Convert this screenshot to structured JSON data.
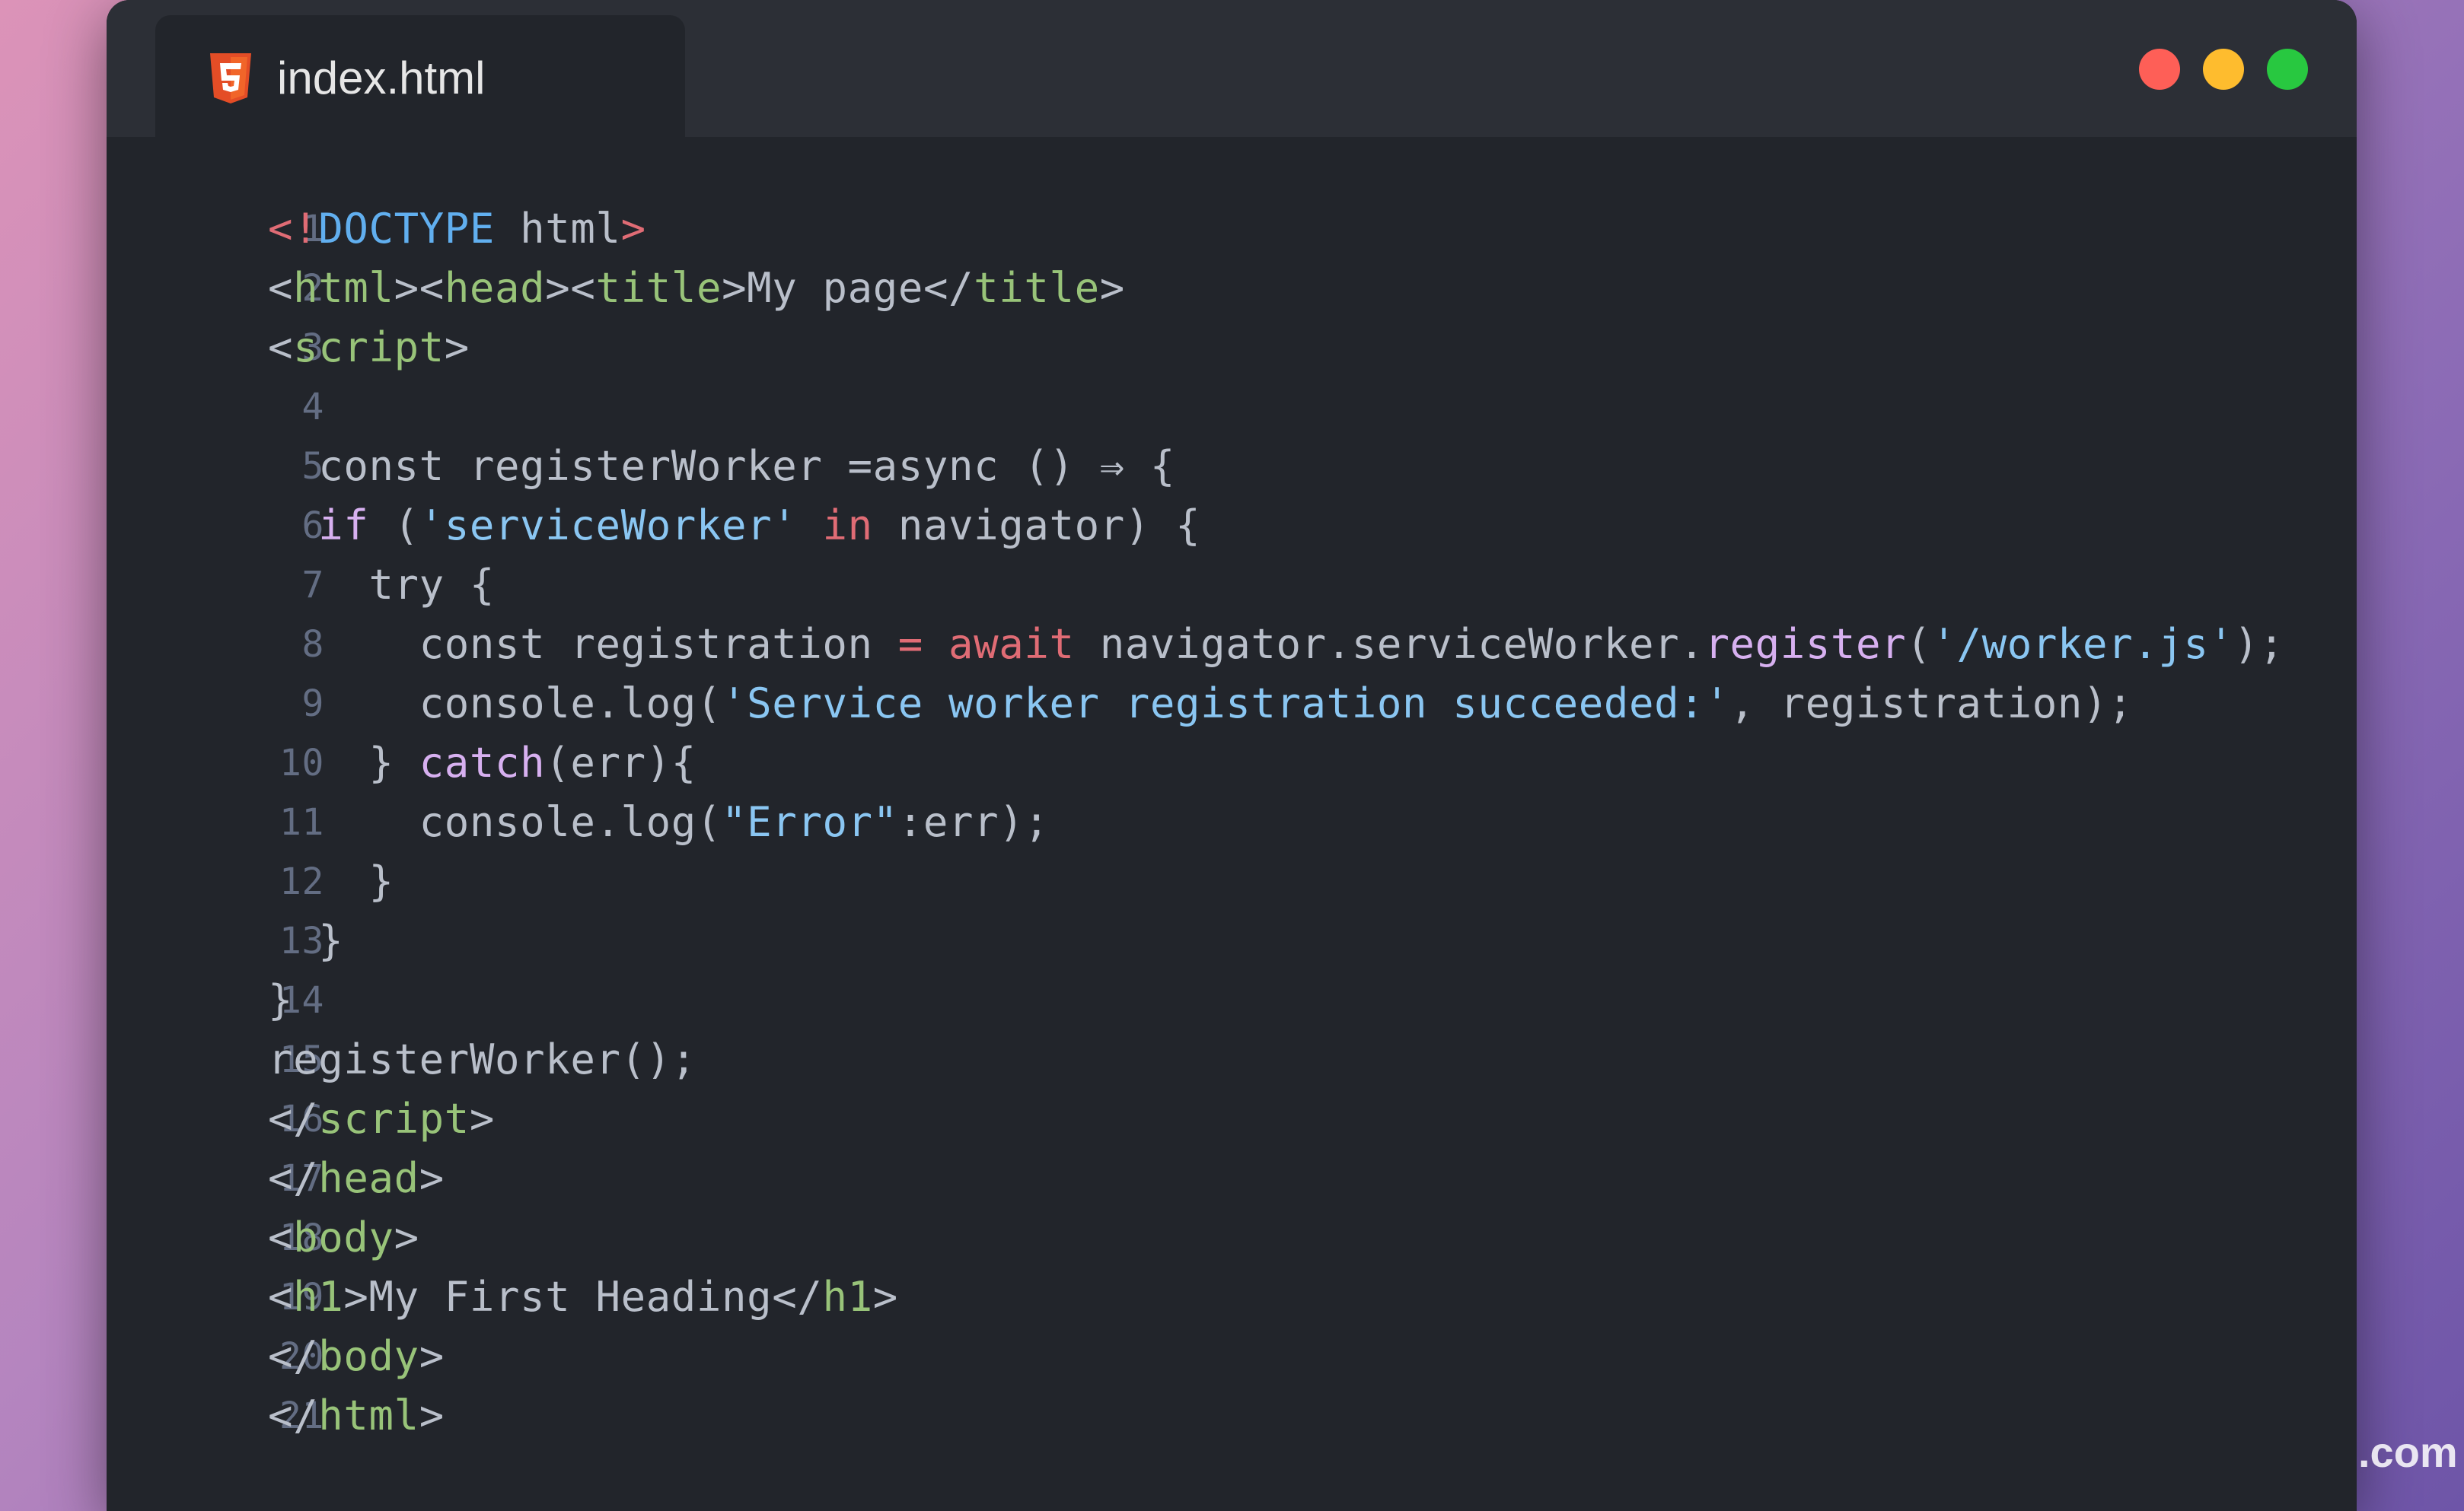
{
  "tab": {
    "title": "index.html",
    "icon": "html5-icon"
  },
  "window_controls": {
    "close_color": "#fe5f57",
    "minimize_color": "#febc2e",
    "maximize_color": "#28c840"
  },
  "colors": {
    "editor_bg": "#22252b",
    "titlebar_bg": "#2c2f36",
    "tag": "#98c379",
    "keyword": "#e06c75",
    "string": "#8ac6f2",
    "function": "#d7b0f0",
    "doctype": "#61afef"
  },
  "code_lines": [
    {
      "n": "1",
      "tokens": [
        {
          "t": "<!",
          "c": "c-red"
        },
        {
          "t": "DOCTYPE",
          "c": "c-blue"
        },
        {
          "t": " html",
          "c": "c-fg"
        },
        {
          "t": ">",
          "c": "c-red"
        }
      ]
    },
    {
      "n": "2",
      "tokens": [
        {
          "t": "<",
          "c": "c-fg"
        },
        {
          "t": "html",
          "c": "c-green"
        },
        {
          "t": "><",
          "c": "c-fg"
        },
        {
          "t": "head",
          "c": "c-green"
        },
        {
          "t": "><",
          "c": "c-fg"
        },
        {
          "t": "title",
          "c": "c-green"
        },
        {
          "t": ">My page</",
          "c": "c-fg"
        },
        {
          "t": "title",
          "c": "c-green"
        },
        {
          "t": ">",
          "c": "c-fg"
        }
      ]
    },
    {
      "n": "3",
      "tokens": [
        {
          "t": "<",
          "c": "c-fg"
        },
        {
          "t": "script",
          "c": "c-green"
        },
        {
          "t": ">",
          "c": "c-fg"
        }
      ]
    },
    {
      "n": "4",
      "tokens": []
    },
    {
      "n": "5",
      "tokens": [
        {
          "t": "  const registerWorker =async () ⇒ {",
          "c": "c-fg"
        }
      ]
    },
    {
      "n": "6",
      "tokens": [
        {
          "t": "  ",
          "c": "c-fg"
        },
        {
          "t": "if",
          "c": "c-purple"
        },
        {
          "t": " (",
          "c": "c-fg"
        },
        {
          "t": "'serviceWorker'",
          "c": "c-str"
        },
        {
          "t": " ",
          "c": "c-fg"
        },
        {
          "t": "in",
          "c": "c-red"
        },
        {
          "t": " navigator) {",
          "c": "c-fg"
        }
      ]
    },
    {
      "n": "7",
      "tokens": [
        {
          "t": "    try {",
          "c": "c-fg"
        }
      ]
    },
    {
      "n": "8",
      "tokens": [
        {
          "t": "      const registration ",
          "c": "c-fg"
        },
        {
          "t": "=",
          "c": "c-red"
        },
        {
          "t": " ",
          "c": "c-fg"
        },
        {
          "t": "await",
          "c": "c-red"
        },
        {
          "t": " navigator.serviceWorker.",
          "c": "c-fg"
        },
        {
          "t": "register",
          "c": "c-purple"
        },
        {
          "t": "(",
          "c": "c-fg"
        },
        {
          "t": "'/worker.js'",
          "c": "c-str"
        },
        {
          "t": ");",
          "c": "c-fg"
        }
      ]
    },
    {
      "n": "9",
      "tokens": [
        {
          "t": "      console.log(",
          "c": "c-fg"
        },
        {
          "t": "'Service worker registration succeeded:'",
          "c": "c-str"
        },
        {
          "t": ", registration);",
          "c": "c-fg"
        }
      ]
    },
    {
      "n": "10",
      "tokens": [
        {
          "t": "    } ",
          "c": "c-fg"
        },
        {
          "t": "catch",
          "c": "c-purple"
        },
        {
          "t": "(err){",
          "c": "c-fg"
        }
      ]
    },
    {
      "n": "11",
      "tokens": [
        {
          "t": "      console.log(",
          "c": "c-fg"
        },
        {
          "t": "\"Error\"",
          "c": "c-str"
        },
        {
          "t": ":err);",
          "c": "c-fg"
        }
      ]
    },
    {
      "n": "12",
      "tokens": [
        {
          "t": "    }",
          "c": "c-fg"
        }
      ]
    },
    {
      "n": "13",
      "tokens": [
        {
          "t": "  }",
          "c": "c-fg"
        }
      ]
    },
    {
      "n": "14",
      "tokens": [
        {
          "t": "}",
          "c": "c-fg"
        }
      ]
    },
    {
      "n": "15",
      "tokens": [
        {
          "t": "registerWorker();",
          "c": "c-fg"
        }
      ]
    },
    {
      "n": "16",
      "tokens": [
        {
          "t": "</",
          "c": "c-fg"
        },
        {
          "t": "script",
          "c": "c-green"
        },
        {
          "t": ">",
          "c": "c-fg"
        }
      ]
    },
    {
      "n": "17",
      "tokens": [
        {
          "t": "</",
          "c": "c-fg"
        },
        {
          "t": "head",
          "c": "c-green"
        },
        {
          "t": ">",
          "c": "c-fg"
        }
      ]
    },
    {
      "n": "18",
      "tokens": [
        {
          "t": "<",
          "c": "c-fg"
        },
        {
          "t": "body",
          "c": "c-green"
        },
        {
          "t": ">",
          "c": "c-fg"
        }
      ]
    },
    {
      "n": "19",
      "tokens": [
        {
          "t": "<",
          "c": "c-fg"
        },
        {
          "t": "h1",
          "c": "c-green"
        },
        {
          "t": ">My First Heading</",
          "c": "c-fg"
        },
        {
          "t": "h1",
          "c": "c-green"
        },
        {
          "t": ">",
          "c": "c-fg"
        }
      ]
    },
    {
      "n": "20",
      "tokens": [
        {
          "t": "</",
          "c": "c-fg"
        },
        {
          "t": "body",
          "c": "c-green"
        },
        {
          "t": ">",
          "c": "c-fg"
        }
      ]
    },
    {
      "n": "21",
      "tokens": [
        {
          "t": "</",
          "c": "c-fg"
        },
        {
          "t": "html",
          "c": "c-green"
        },
        {
          "t": ">",
          "c": "c-fg"
        }
      ]
    }
  ],
  "watermark": ".com"
}
